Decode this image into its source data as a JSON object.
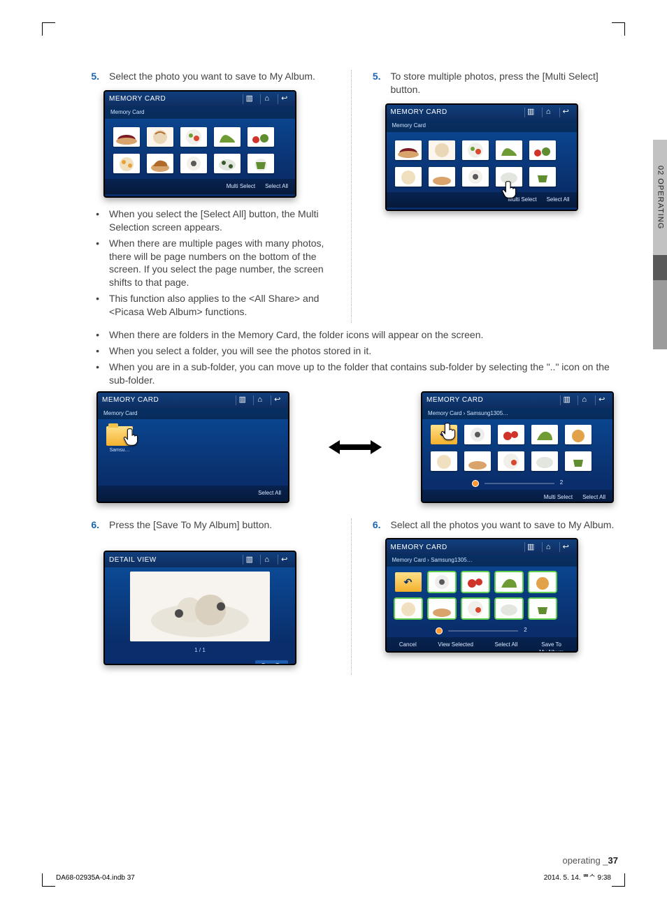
{
  "sideTab": "02  OPERATING",
  "left": {
    "step5_num": "5.",
    "step5_text": "Select the photo you want to save to My Album.",
    "bullets": [
      "When you select the [Select All] button, the Multi Selection screen appears.",
      "When there are multiple pages with many photos, there will be page numbers on the bottom of the screen. If you select the page number, the screen shifts to that page.",
      "This function also applies to the <All Share> and <Picasa Web Album> functions."
    ],
    "step6_num": "6.",
    "step6_text": "Press the [Save To My Album] button."
  },
  "right": {
    "step5_num": "5.",
    "step5_text": "To store multiple photos, press the [Multi Select] button.",
    "step6_num": "6.",
    "step6_text": "Select all the photos you want to save to My Album."
  },
  "wideBullets": [
    "When there are folders in the Memory Card, the folder icons will appear on the screen.",
    "When you select a folder, you will see the photos stored in it.",
    "When you are in a sub-folder, you can move up to the folder that contains sub-folder by selecting the \"..\" icon on the sub-folder."
  ],
  "screens": {
    "memcard_title": "MEMORY CARD",
    "detail_title": "DETAIL VIEW",
    "crumb_root": "Memory Card",
    "crumb_sub": "Memory Card   ›   Samsung1305…",
    "btn_multiselect": "Multi Select",
    "btn_selectall": "Select All",
    "btn_cancel": "Cancel",
    "btn_view_selected": "View Selected",
    "btn_save_my_album": "Save To\nMy Album",
    "page_ind": "1 / 1",
    "page2": "2"
  },
  "footer": {
    "label": "operating _",
    "page": "37",
    "indb": "DA68-02935A-04.indb   37",
    "date": "2014. 5. 14.   ᄈᄉ 9:38"
  }
}
